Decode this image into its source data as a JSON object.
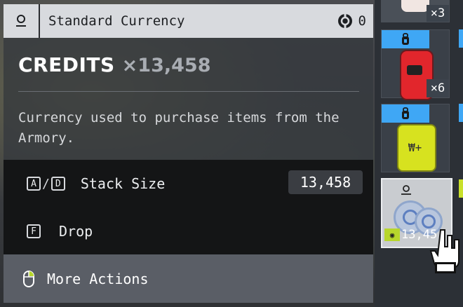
{
  "header": {
    "title": "Standard Currency",
    "count": "0",
    "icon_left": "currency-tier-icon",
    "icon_right": "credits-coin-icon"
  },
  "item": {
    "name": "CREDITS",
    "quantity": "×13,458",
    "description": "Currency used to purchase items from the Armory."
  },
  "actions": [
    {
      "keys": [
        "A",
        "D"
      ],
      "separator": "/",
      "label": "Stack Size",
      "value": "13,458"
    },
    {
      "keys": [
        "F"
      ],
      "label": "Drop"
    }
  ],
  "more_actions": {
    "label": "More Actions",
    "icon": "mouse-right-click-icon"
  },
  "inventory": {
    "slots": [
      {
        "count": "×3"
      },
      {
        "count": "×6"
      },
      {
        "count": ""
      },
      {
        "count": "13,45",
        "selected": true
      }
    ]
  },
  "colors": {
    "header_bg": "#d8dade",
    "panel_bg": "#34383e",
    "actions_bg": "#141516",
    "more_bg": "#5a5e66",
    "slot_accent": "#3fa7f5",
    "yellow_badge": "#b7d62c"
  }
}
